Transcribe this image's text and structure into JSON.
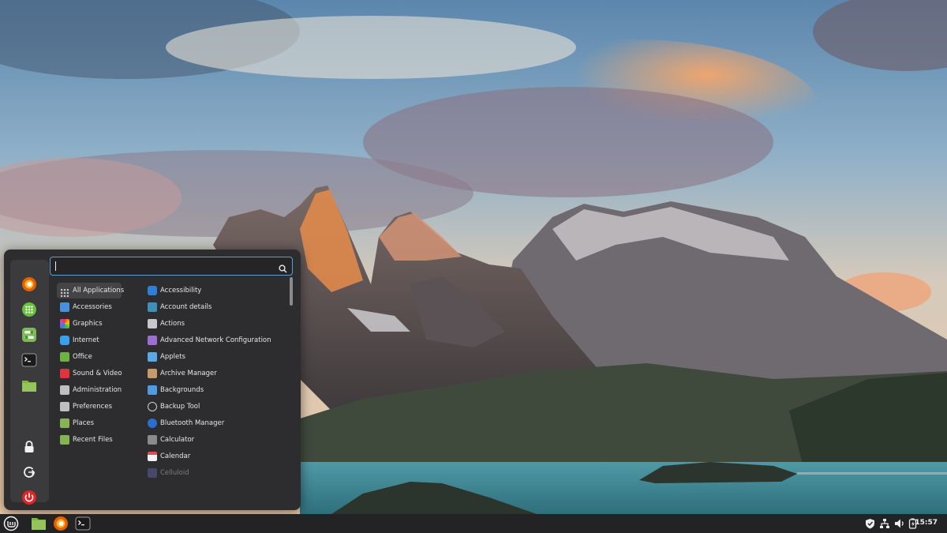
{
  "search": {
    "value": "",
    "placeholder": ""
  },
  "favorites": [
    {
      "name": "firefox-icon"
    },
    {
      "name": "software-manager-icon"
    },
    {
      "name": "settings-icon"
    },
    {
      "name": "terminal-icon"
    },
    {
      "name": "files-icon"
    }
  ],
  "session": [
    {
      "name": "lock-screen-icon"
    },
    {
      "name": "logout-icon"
    },
    {
      "name": "shutdown-icon"
    }
  ],
  "categories": [
    {
      "label": "All Applications",
      "color": "#9a9a9a",
      "active": true
    },
    {
      "label": "Accessories",
      "color": "#4a8fdb"
    },
    {
      "label": "Graphics",
      "color": "#d24ba0"
    },
    {
      "label": "Internet",
      "color": "#3aa0e8"
    },
    {
      "label": "Office",
      "color": "#6db33f"
    },
    {
      "label": "Sound & Video",
      "color": "#e0323f"
    },
    {
      "label": "Administration",
      "color": "#bfbfbf"
    },
    {
      "label": "Preferences",
      "color": "#bfbfbf"
    },
    {
      "label": "Places",
      "color": "#86b454"
    },
    {
      "label": "Recent Files",
      "color": "#86b454"
    }
  ],
  "apps": [
    {
      "label": "Accessibility",
      "color": "#2f7fd6"
    },
    {
      "label": "Account details",
      "color": "#3f8fb8"
    },
    {
      "label": "Actions",
      "color": "#c8c8c8"
    },
    {
      "label": "Advanced Network Configuration",
      "color": "#9b6fd1"
    },
    {
      "label": "Applets",
      "color": "#5aa8e6"
    },
    {
      "label": "Archive Manager",
      "color": "#c79a6a"
    },
    {
      "label": "Backgrounds",
      "color": "#4f9ae0"
    },
    {
      "label": "Backup Tool",
      "color": "#d0d0d0"
    },
    {
      "label": "Bluetooth Manager",
      "color": "#2a6fd0"
    },
    {
      "label": "Calculator",
      "color": "#8a8a8a"
    },
    {
      "label": "Calendar",
      "color": "#e8e8e8"
    },
    {
      "label": "Celluloid",
      "color": "#5d5a8f",
      "faded": true
    }
  ],
  "taskbar": {
    "items": [
      {
        "name": "mint-menu-icon"
      },
      {
        "name": "files-icon"
      },
      {
        "name": "firefox-icon"
      },
      {
        "name": "terminal-icon"
      }
    ],
    "clock": "15:57"
  },
  "colors": {
    "accent": "#5a9fd4",
    "mint_green": "#86be43",
    "firefox_orange": "#e66000",
    "power_red": "#e02424"
  }
}
